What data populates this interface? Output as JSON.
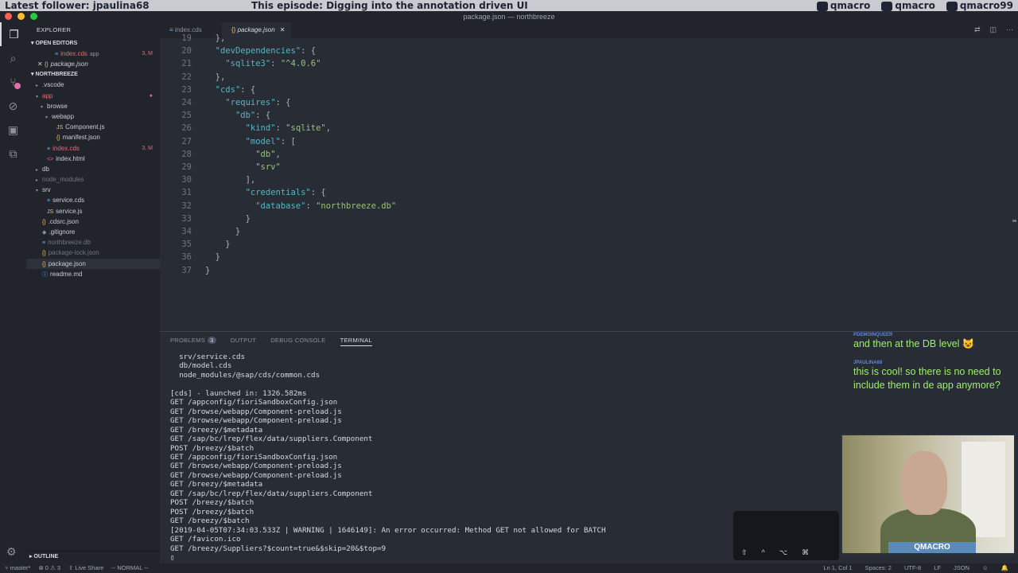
{
  "stream": {
    "follower": "Latest follower: jpaulina68",
    "episode": "This episode: Digging into the annotation driven UI",
    "social": [
      "qmacro",
      "qmacro",
      "qmacro99"
    ]
  },
  "window": {
    "title": "package.json — northbreeze"
  },
  "explorer": {
    "title": "EXPLORER",
    "open_editors_label": "OPEN EDITORS",
    "open_editors": [
      {
        "icon": "cds-file-icon",
        "name": "index.cds",
        "hint": "app",
        "meta": "3, M"
      },
      {
        "icon": "json-file-icon",
        "name": "package.json",
        "hint": "",
        "meta": ""
      }
    ],
    "project_label": "NORTHBREEZE",
    "tree": [
      {
        "indent": 1,
        "tw": "▸",
        "name": "vscode",
        "display": ".vscode",
        "color": "#c7ccd4",
        "meta": ""
      },
      {
        "indent": 1,
        "tw": "▾",
        "name": "app",
        "display": "app",
        "color": "#e06c75",
        "meta": "●"
      },
      {
        "indent": 2,
        "tw": "▾",
        "name": "browse",
        "display": "browse",
        "color": "#c7ccd4",
        "meta": ""
      },
      {
        "indent": 3,
        "tw": "▾",
        "name": "webapp",
        "display": "webapp",
        "color": "#c7ccd4",
        "meta": ""
      },
      {
        "indent": 4,
        "tw": "",
        "name": "component-js",
        "display": "Component.js",
        "icon": "JS",
        "color": "#c7ccd4",
        "meta": ""
      },
      {
        "indent": 4,
        "tw": "",
        "name": "manifest-json",
        "display": "manifest.json",
        "icon": "{}",
        "color": "#c7ccd4",
        "meta": ""
      },
      {
        "indent": 2,
        "tw": "",
        "name": "index-cds",
        "display": "index.cds",
        "icon": "≡",
        "color": "#e06c75",
        "meta": "3, M"
      },
      {
        "indent": 2,
        "tw": "",
        "name": "index-html",
        "display": "index.html",
        "icon": "<>",
        "color": "#c7ccd4",
        "meta": ""
      },
      {
        "indent": 1,
        "tw": "▸",
        "name": "db",
        "display": "db",
        "color": "#c7ccd4",
        "meta": ""
      },
      {
        "indent": 1,
        "tw": "▸",
        "name": "node-modules",
        "display": "node_modules",
        "color": "#6f7682",
        "meta": ""
      },
      {
        "indent": 1,
        "tw": "▾",
        "name": "srv",
        "display": "srv",
        "color": "#c7ccd4",
        "meta": ""
      },
      {
        "indent": 2,
        "tw": "",
        "name": "service-cds",
        "display": "service.cds",
        "icon": "≡",
        "color": "#c7ccd4",
        "meta": ""
      },
      {
        "indent": 2,
        "tw": "",
        "name": "service-js",
        "display": "service.js",
        "icon": "JS",
        "color": "#c7ccd4",
        "meta": ""
      },
      {
        "indent": 1,
        "tw": "",
        "name": "cdsrc-json",
        "display": ".cdsrc.json",
        "icon": "{}",
        "color": "#c7ccd4",
        "meta": ""
      },
      {
        "indent": 1,
        "tw": "",
        "name": "gitignore",
        "display": ".gitignore",
        "icon": "◆",
        "color": "#c7ccd4",
        "meta": ""
      },
      {
        "indent": 1,
        "tw": "",
        "name": "northbreeze-db",
        "display": "northbreeze.db",
        "icon": "≡",
        "color": "#6f7682",
        "meta": ""
      },
      {
        "indent": 1,
        "tw": "",
        "name": "package-lock-json",
        "display": "package-lock.json",
        "icon": "{}",
        "color": "#6f7682",
        "meta": ""
      },
      {
        "indent": 1,
        "tw": "",
        "name": "package-json",
        "display": "package.json",
        "icon": "{}",
        "color": "#c7ccd4",
        "meta": "",
        "selected": true
      },
      {
        "indent": 1,
        "tw": "",
        "name": "readme-md",
        "display": "readme.md",
        "icon": "ⓘ",
        "color": "#c7ccd4",
        "meta": ""
      }
    ],
    "outline_label": "OUTLINE"
  },
  "tabs": [
    {
      "label": "index.cds",
      "active": false
    },
    {
      "label": "package.json",
      "active": true
    }
  ],
  "editor": {
    "lines": [
      {
        "n": "19",
        "t": "  },",
        "partial": true
      },
      {
        "n": "20",
        "t": "  \"devDependencies\": {"
      },
      {
        "n": "21",
        "t": "    \"sqlite3\": \"^4.0.6\""
      },
      {
        "n": "22",
        "t": "  },"
      },
      {
        "n": "23",
        "t": "  \"cds\": {"
      },
      {
        "n": "24",
        "t": "    \"requires\": {"
      },
      {
        "n": "25",
        "t": "      \"db\": {"
      },
      {
        "n": "26",
        "t": "        \"kind\": \"sqlite\","
      },
      {
        "n": "27",
        "t": "        \"model\": ["
      },
      {
        "n": "28",
        "t": "          \"db\","
      },
      {
        "n": "29",
        "t": "          \"srv\""
      },
      {
        "n": "30",
        "t": "        ],"
      },
      {
        "n": "31",
        "t": "        \"credentials\": {"
      },
      {
        "n": "32",
        "t": "          \"database\": \"northbreeze.db\""
      },
      {
        "n": "33",
        "t": "        }"
      },
      {
        "n": "34",
        "t": "      }"
      },
      {
        "n": "35",
        "t": "    }"
      },
      {
        "n": "36",
        "t": "  }"
      },
      {
        "n": "37",
        "t": "}"
      }
    ]
  },
  "panel": {
    "tabs": [
      {
        "label": "PROBLEMS",
        "count": "3"
      },
      {
        "label": "OUTPUT"
      },
      {
        "label": "DEBUG CONSOLE"
      },
      {
        "label": "TERMINAL",
        "active": true
      }
    ],
    "terminal": [
      "  srv/service.cds",
      "  db/model.cds",
      "  node_modules/@sap/cds/common.cds",
      "",
      "[cds] - launched in: 1326.582ms",
      "GET /appconfig/fioriSandboxConfig.json",
      "GET /browse/webapp/Component-preload.js",
      "GET /browse/webapp/Component-preload.js",
      "GET /breezy/$metadata",
      "GET /sap/bc/lrep/flex/data/suppliers.Component",
      "POST /breezy/$batch",
      "GET /appconfig/fioriSandboxConfig.json",
      "GET /browse/webapp/Component-preload.js",
      "GET /browse/webapp/Component-preload.js",
      "GET /breezy/$metadata",
      "GET /sap/bc/lrep/flex/data/suppliers.Component",
      "POST /breezy/$batch",
      "POST /breezy/$batch",
      "GET /breezy/$batch",
      "[2019-04-05T07:34:03.533Z | WARNING | 1646149]: An error occurred: Method GET not allowed for BATCH",
      "GET /favicon.ico",
      "GET /breezy/Suppliers?$count=true&$skip=20&$top=9",
      "▯"
    ]
  },
  "chat": {
    "messages": [
      {
        "author": "PDEMOINQUEER",
        "text": "and then at the DB level 😺"
      },
      {
        "author": "JPAULINA68",
        "text": "this is cool! so there is no need to include them in de app anymore?"
      }
    ]
  },
  "webcam": {
    "tag": "QMACRO"
  },
  "statusbar": {
    "branch": "master*",
    "problems": "⊗ 0 ⚠ 3",
    "liveshare": "Live Share",
    "mode": "-- NORMAL --",
    "cursor": "Ln 1, Col 1",
    "spaces": "Spaces: 2",
    "encoding": "UTF-8",
    "eol": "LF",
    "language": "JSON"
  }
}
